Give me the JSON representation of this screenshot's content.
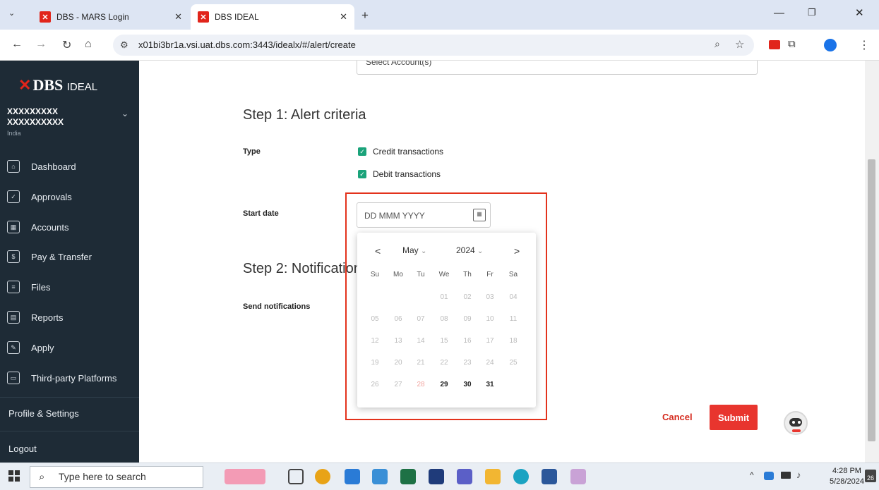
{
  "browser": {
    "tabs": [
      {
        "label": "DBS - MARS Login",
        "favicon": "dbs-favicon"
      },
      {
        "label": "DBS IDEAL",
        "favicon": "dbs-favicon"
      }
    ],
    "url": "x01bi3br1a.vsi.uat.dbs.com:3443/idealx/#/alert/create"
  },
  "sidebar": {
    "logo": {
      "brand": "DBS",
      "product": "IDEAL"
    },
    "account": {
      "line1": "XXXXXXXXX",
      "line2": "XXXXXXXXXX",
      "country": "India"
    },
    "items": [
      {
        "label": "Dashboard",
        "icon": "home-icon"
      },
      {
        "label": "Approvals",
        "icon": "approvals-icon"
      },
      {
        "label": "Accounts",
        "icon": "bank-icon"
      },
      {
        "label": "Pay & Transfer",
        "icon": "transfer-icon"
      },
      {
        "label": "Files",
        "icon": "file-icon"
      },
      {
        "label": "Reports",
        "icon": "reports-icon"
      },
      {
        "label": "Apply",
        "icon": "apply-icon"
      },
      {
        "label": "Third-party Platforms",
        "icon": "platforms-icon"
      }
    ],
    "profile": "Profile & Settings",
    "logout": "Logout"
  },
  "main": {
    "select_accounts_placeholder": "Select Account(s)",
    "step1_title": "Step 1: Alert criteria",
    "type_label": "Type",
    "checkbox_credit": "Credit transactions",
    "checkbox_debit": "Debit transactions",
    "start_date_label": "Start date",
    "date_placeholder": "DD MMM YYYY",
    "step2_title": "Step 2: Notification",
    "send_notifications_label": "Send notifications",
    "cancel": "Cancel",
    "submit": "Submit"
  },
  "calendar": {
    "month": "May",
    "year": "2024",
    "prev": "<",
    "next": ">",
    "weekdays": [
      "Su",
      "Mo",
      "Tu",
      "We",
      "Th",
      "Fr",
      "Sa"
    ],
    "weeks": [
      [
        "",
        "",
        "",
        "01",
        "02",
        "03",
        "04"
      ],
      [
        "05",
        "06",
        "07",
        "08",
        "09",
        "10",
        "11"
      ],
      [
        "12",
        "13",
        "14",
        "15",
        "16",
        "17",
        "18"
      ],
      [
        "19",
        "20",
        "21",
        "22",
        "23",
        "24",
        "25"
      ],
      [
        "26",
        "27",
        "28",
        "29",
        "30",
        "31",
        ""
      ]
    ],
    "today": "28",
    "enabled_days": [
      "29",
      "30",
      "31"
    ]
  },
  "taskbar": {
    "search_placeholder": "Type here to search",
    "time": "4:28 PM",
    "date": "5/28/2024",
    "notification_count": "26"
  },
  "colors": {
    "accent": "#e8352e",
    "sidebar_bg": "#1e2b36",
    "check": "#1aa37a",
    "highlight": "#e3321c"
  }
}
